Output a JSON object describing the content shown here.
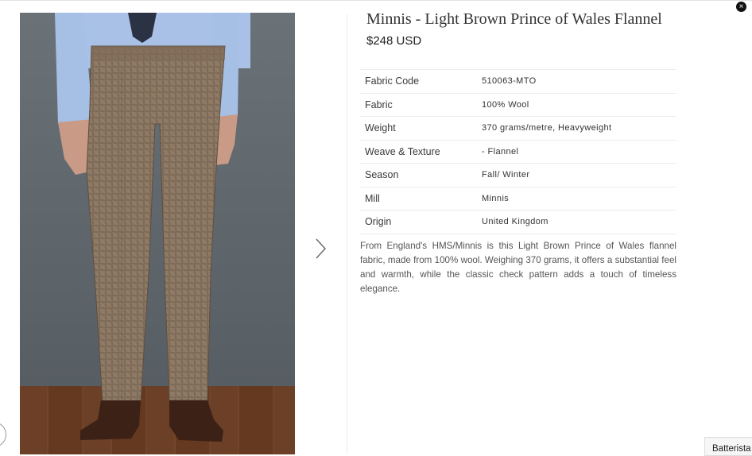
{
  "product": {
    "title": "Minnis - Light Brown Prince of Wales Flannel",
    "price": "$248 USD",
    "specs": [
      {
        "label": "Fabric Code",
        "value": "510063-MTO"
      },
      {
        "label": "Fabric",
        "value": "100% Wool"
      },
      {
        "label": "Weight",
        "value": "370 grams/metre, Heavyweight"
      },
      {
        "label": "Weave & Texture",
        "value": "- Flannel"
      },
      {
        "label": "Season",
        "value": "Fall/ Winter"
      },
      {
        "label": "Mill",
        "value": "Minnis"
      },
      {
        "label": "Origin",
        "value": "United Kingdom"
      }
    ],
    "description": "From England's HMS/Minnis is this Light Brown Prince of Wales flannel fabric, made from 100% wool. Weighing 370 grams, it offers a substantial feel and warmth, while the classic check pattern adds a touch of timeless elegance."
  },
  "controls": {
    "close_icon": "×",
    "chat_tab_label": "Batterista"
  },
  "icons": {
    "next": "chevron-right-icon",
    "close": "close-icon"
  },
  "colors": {
    "trouser": "#8b7762",
    "shirt": "#a9c1e6",
    "backdrop": "#636b71",
    "floor": "#6b4026"
  }
}
